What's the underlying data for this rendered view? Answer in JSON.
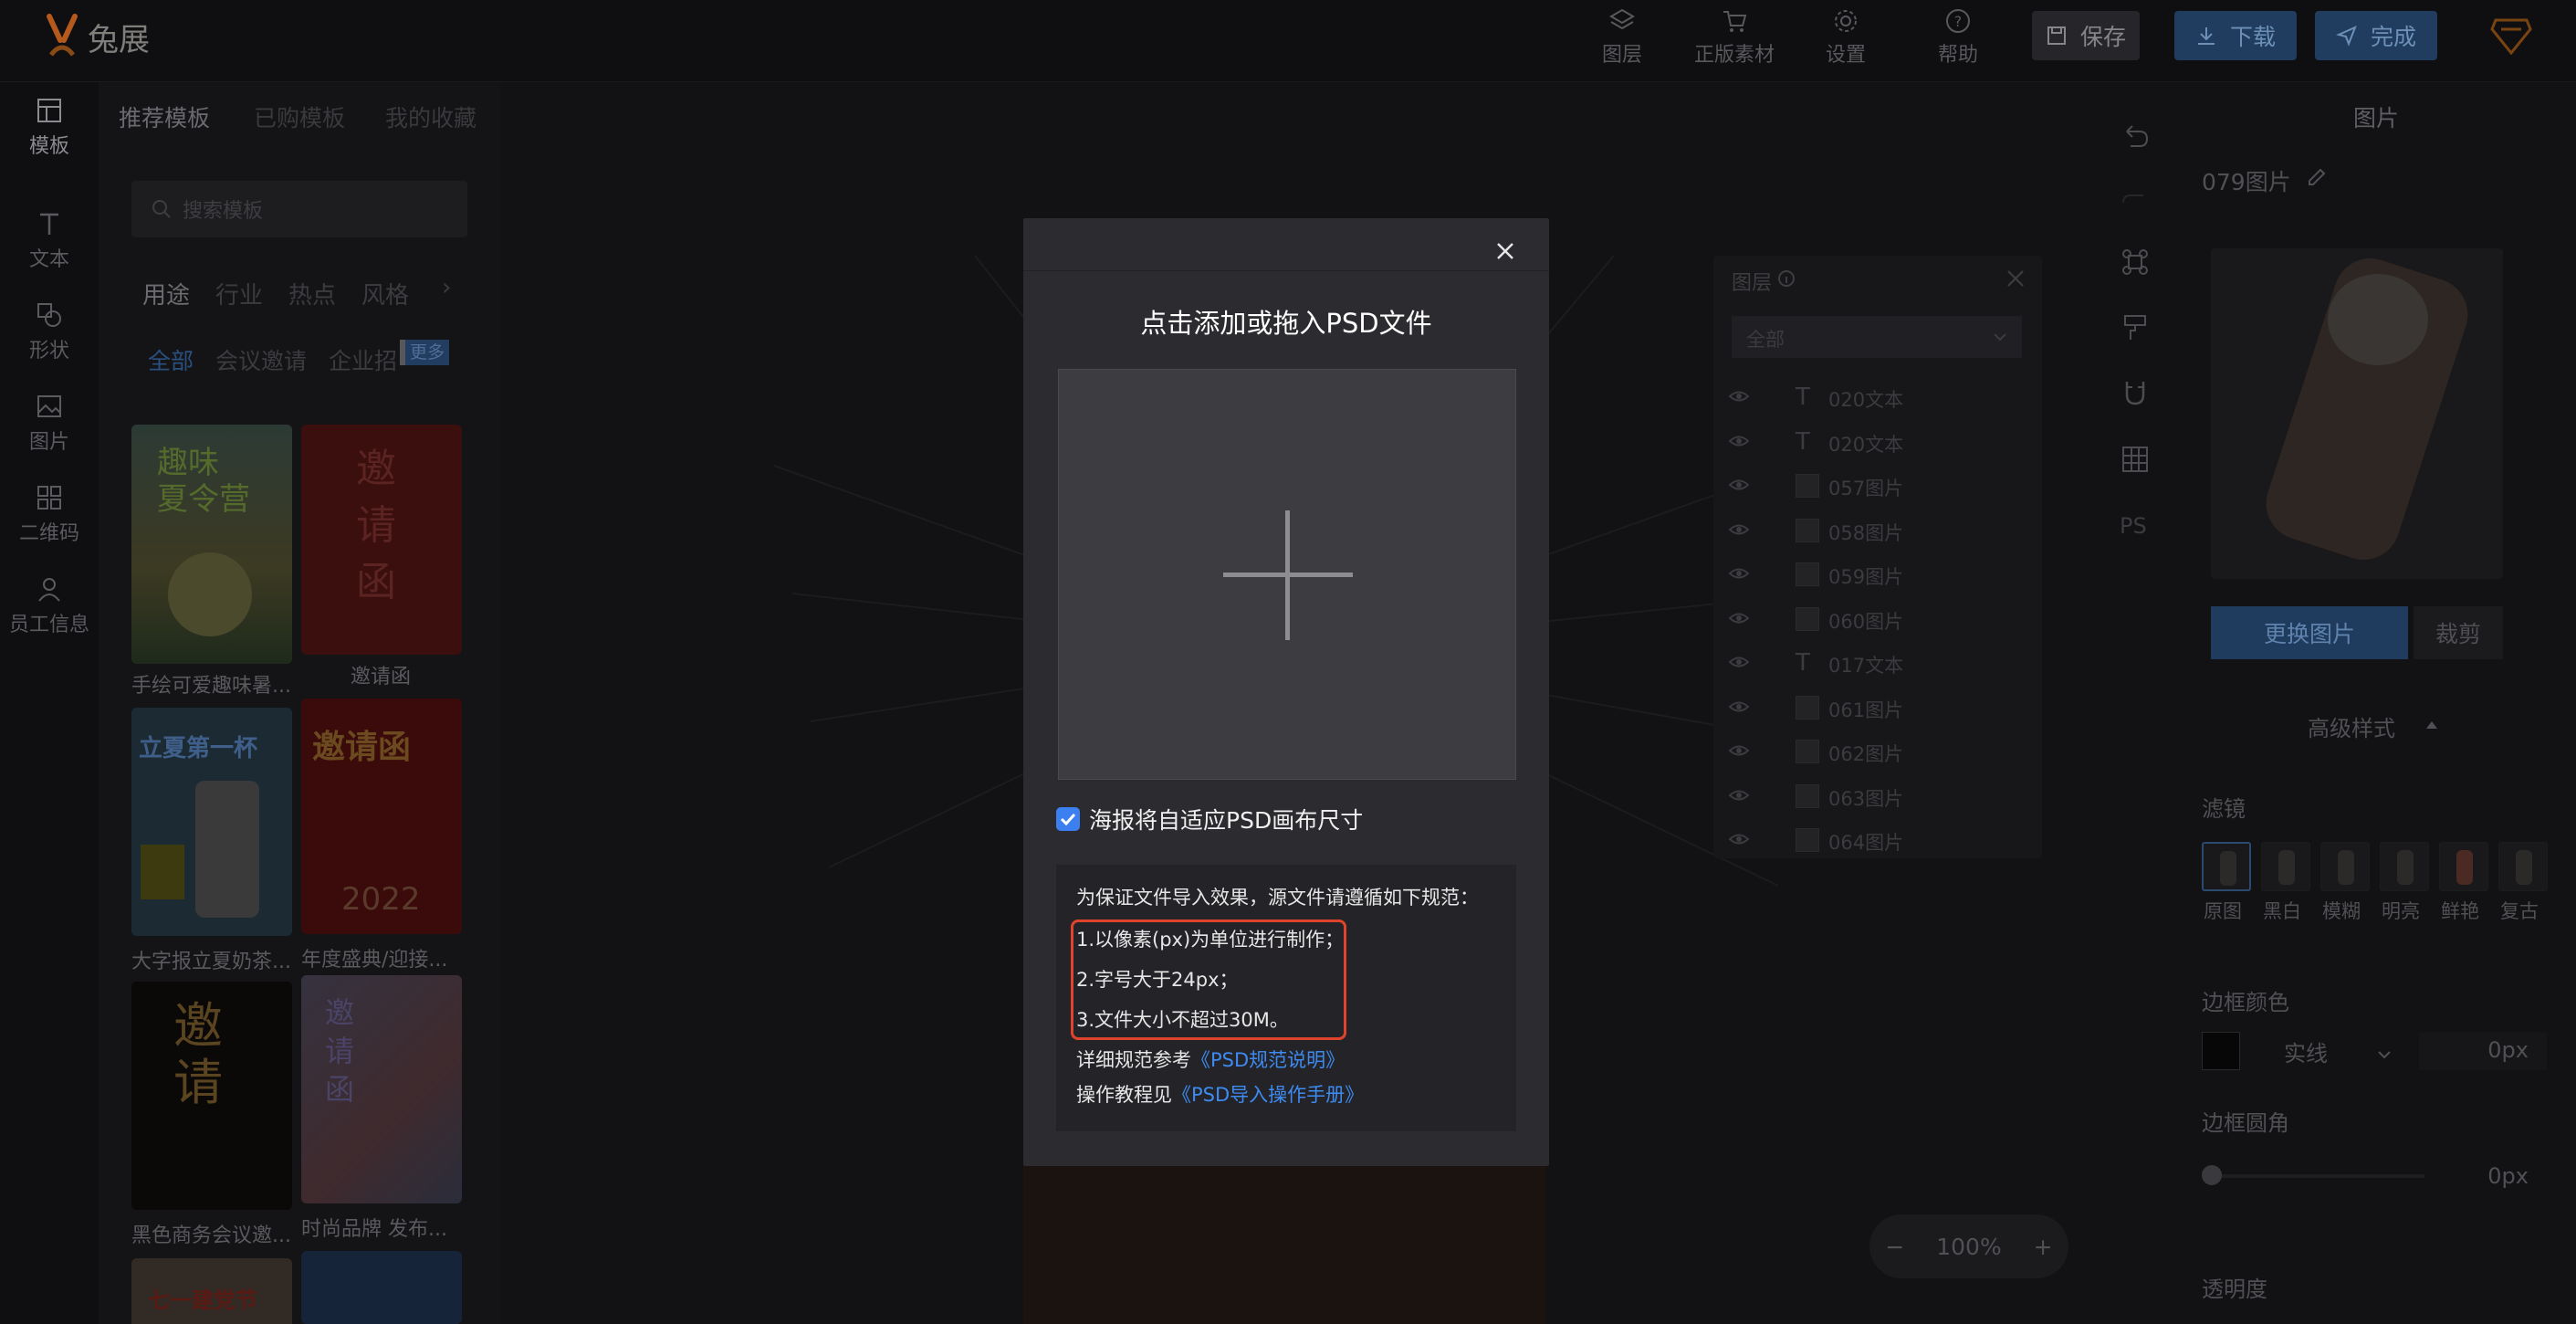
{
  "header": {
    "brand": "兔展",
    "layers_label": "图层",
    "assets_label": "正版素材",
    "settings_label": "设置",
    "help_label": "帮助",
    "save_label": "保存",
    "download_label": "下载",
    "finish_label": "完成"
  },
  "rail": {
    "template": "模板",
    "text": "文本",
    "shape": "形状",
    "image": "图片",
    "qrcode": "二维码",
    "staff": "员工信息"
  },
  "templates": {
    "tabs": [
      "推荐模板",
      "已购模板",
      "我的收藏"
    ],
    "search_placeholder": "搜索模板",
    "categories": [
      "用途",
      "行业",
      "热点",
      "风格"
    ],
    "tags": [
      "全部",
      "会议邀请",
      "企业招"
    ],
    "more": "更多",
    "cards": [
      {
        "title": "手绘可爱趣味暑...",
        "art": "趣味\n夏令营"
      },
      {
        "title": "邀请函",
        "art": "邀\n请\n函"
      },
      {
        "title": "大字报立夏奶茶...",
        "art": "立夏第一杯"
      },
      {
        "title": "年度盛典/迎接...",
        "art": "邀请函"
      },
      {
        "title": "黑色商务会议邀...",
        "art": "邀\n请"
      },
      {
        "title": "时尚品牌 发布...",
        "art": "邀\n请\n函"
      },
      {
        "title": "",
        "art": "七一建党节"
      },
      {
        "title": "",
        "art": ""
      }
    ]
  },
  "layers": {
    "title": "图层",
    "filter": "全部",
    "items": [
      {
        "type": "text",
        "name": "020文本"
      },
      {
        "type": "text",
        "name": "020文本"
      },
      {
        "type": "image",
        "name": "057图片"
      },
      {
        "type": "image",
        "name": "058图片"
      },
      {
        "type": "image",
        "name": "059图片"
      },
      {
        "type": "image",
        "name": "060图片"
      },
      {
        "type": "text",
        "name": "017文本"
      },
      {
        "type": "image",
        "name": "061图片"
      },
      {
        "type": "image",
        "name": "062图片"
      },
      {
        "type": "image",
        "name": "063图片"
      },
      {
        "type": "image",
        "name": "064图片"
      }
    ]
  },
  "zoom": {
    "minus": "−",
    "value": "100%",
    "plus": "+"
  },
  "props": {
    "panel_title": "图片",
    "element_name": "079图片",
    "replace_label": "更换图片",
    "crop_label": "裁剪",
    "advanced_label": "高级样式",
    "filter_label": "滤镜",
    "filters": [
      "原图",
      "黑白",
      "模糊",
      "明亮",
      "鲜艳",
      "复古"
    ],
    "border_color_label": "边框颜色",
    "border_style": "实线",
    "border_width": "0px",
    "border_radius_label": "边框圆角",
    "border_radius_value": "0px",
    "opacity_label": "透明度"
  },
  "modal": {
    "title": "点击添加或拖入PSD文件",
    "fit_label": "海报将自适应PSD画布尺寸",
    "fit_checked": true,
    "rules_intro": "为保证文件导入效果，源文件请遵循如下规范：",
    "rule1": "1.以像素(px)为单位进行制作；",
    "rule2": "2.字号大于24px；",
    "rule3": "3.文件大小不超过30M。",
    "spec_prefix": "详细规范参考",
    "spec_link": "《PSD规范说明》",
    "manual_prefix": "操作教程见",
    "manual_link": "《PSD导入操作手册》"
  },
  "colors": {
    "accent": "#3b7ff0",
    "highlight": "#e0432c"
  }
}
